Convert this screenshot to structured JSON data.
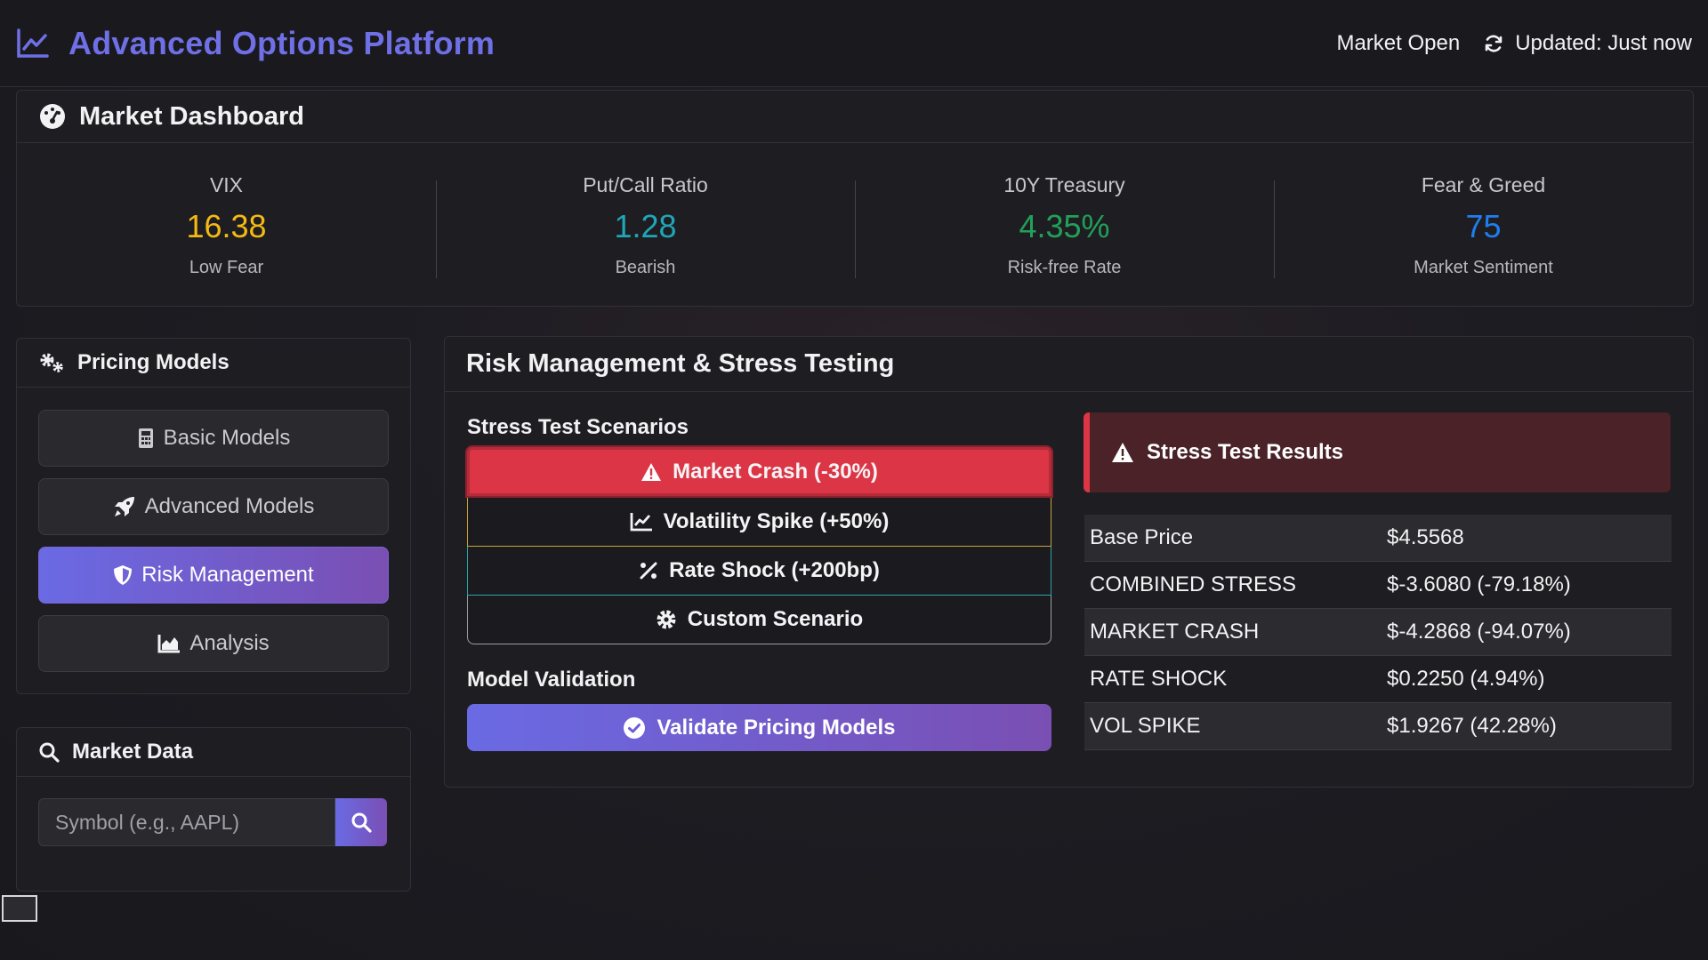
{
  "app": {
    "title": "Advanced Options Platform"
  },
  "header": {
    "market_status": "Market Open",
    "updated": "Updated: Just now"
  },
  "dashboard": {
    "title": "Market Dashboard",
    "metrics": [
      {
        "label": "VIX",
        "value": "16.38",
        "sub": "Low Fear",
        "color": "#f5b914"
      },
      {
        "label": "Put/Call Ratio",
        "value": "1.28",
        "sub": "Bearish",
        "color": "#1fa6b8"
      },
      {
        "label": "10Y Treasury",
        "value": "4.35%",
        "sub": "Risk-free Rate",
        "color": "#22a05a"
      },
      {
        "label": "Fear & Greed",
        "value": "75",
        "sub": "Market Sentiment",
        "color": "#1e7ef0"
      }
    ]
  },
  "pricing_models": {
    "title": "Pricing Models",
    "items": [
      {
        "label": "Basic Models",
        "icon": "calculator-icon"
      },
      {
        "label": "Advanced Models",
        "icon": "rocket-icon"
      },
      {
        "label": "Risk Management",
        "icon": "shield-icon",
        "active": true
      },
      {
        "label": "Analysis",
        "icon": "area-chart-icon"
      }
    ]
  },
  "market_data": {
    "title": "Market Data",
    "placeholder": "Symbol (e.g., AAPL)"
  },
  "risk": {
    "title": "Risk Management & Stress Testing",
    "scenarios_label": "Stress Test Scenarios",
    "scenarios": [
      "Market Crash (-30%)",
      "Volatility Spike (+50%)",
      "Rate Shock (+200bp)",
      "Custom Scenario"
    ],
    "validation_label": "Model Validation",
    "validate_button": "Validate Pricing Models",
    "results_title": "Stress Test Results",
    "results": [
      {
        "name": "Base Price",
        "value": "$4.5568"
      },
      {
        "name": "COMBINED STRESS",
        "value": "$-3.6080 (-79.18%)"
      },
      {
        "name": "MARKET CRASH",
        "value": "$-4.2868 (-94.07%)"
      },
      {
        "name": "RATE SHOCK",
        "value": "$0.2250 (4.94%)"
      },
      {
        "name": "VOL SPIKE",
        "value": "$1.9267 (42.28%)"
      }
    ]
  },
  "colors": {
    "accent": "#6a6ae4",
    "danger": "#dc3545"
  }
}
